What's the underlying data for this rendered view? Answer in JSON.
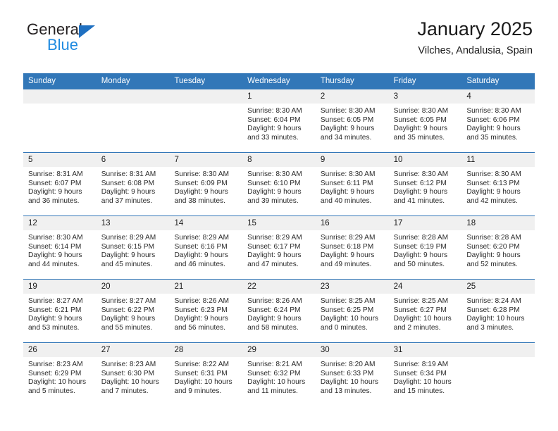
{
  "brand": {
    "name_top": "General",
    "name_bottom": "Blue",
    "triangle_color": "#1f70c1",
    "blue_text_color": "#1f8ae0"
  },
  "header": {
    "title": "January 2025",
    "subtitle": "Vilches, Andalusia, Spain"
  },
  "theme": {
    "header_blue": "#3277b8",
    "daynum_band": "#f0f0f0",
    "cell_bg": "#ffffff",
    "text": "#1a1a1a"
  },
  "weekdays": [
    "Sunday",
    "Monday",
    "Tuesday",
    "Wednesday",
    "Thursday",
    "Friday",
    "Saturday"
  ],
  "weeks": [
    [
      {
        "day": "",
        "lines": []
      },
      {
        "day": "",
        "lines": []
      },
      {
        "day": "",
        "lines": []
      },
      {
        "day": "1",
        "lines": [
          "Sunrise: 8:30 AM",
          "Sunset: 6:04 PM",
          "Daylight: 9 hours",
          "and 33 minutes."
        ]
      },
      {
        "day": "2",
        "lines": [
          "Sunrise: 8:30 AM",
          "Sunset: 6:05 PM",
          "Daylight: 9 hours",
          "and 34 minutes."
        ]
      },
      {
        "day": "3",
        "lines": [
          "Sunrise: 8:30 AM",
          "Sunset: 6:05 PM",
          "Daylight: 9 hours",
          "and 35 minutes."
        ]
      },
      {
        "day": "4",
        "lines": [
          "Sunrise: 8:30 AM",
          "Sunset: 6:06 PM",
          "Daylight: 9 hours",
          "and 35 minutes."
        ]
      }
    ],
    [
      {
        "day": "5",
        "lines": [
          "Sunrise: 8:31 AM",
          "Sunset: 6:07 PM",
          "Daylight: 9 hours",
          "and 36 minutes."
        ]
      },
      {
        "day": "6",
        "lines": [
          "Sunrise: 8:31 AM",
          "Sunset: 6:08 PM",
          "Daylight: 9 hours",
          "and 37 minutes."
        ]
      },
      {
        "day": "7",
        "lines": [
          "Sunrise: 8:30 AM",
          "Sunset: 6:09 PM",
          "Daylight: 9 hours",
          "and 38 minutes."
        ]
      },
      {
        "day": "8",
        "lines": [
          "Sunrise: 8:30 AM",
          "Sunset: 6:10 PM",
          "Daylight: 9 hours",
          "and 39 minutes."
        ]
      },
      {
        "day": "9",
        "lines": [
          "Sunrise: 8:30 AM",
          "Sunset: 6:11 PM",
          "Daylight: 9 hours",
          "and 40 minutes."
        ]
      },
      {
        "day": "10",
        "lines": [
          "Sunrise: 8:30 AM",
          "Sunset: 6:12 PM",
          "Daylight: 9 hours",
          "and 41 minutes."
        ]
      },
      {
        "day": "11",
        "lines": [
          "Sunrise: 8:30 AM",
          "Sunset: 6:13 PM",
          "Daylight: 9 hours",
          "and 42 minutes."
        ]
      }
    ],
    [
      {
        "day": "12",
        "lines": [
          "Sunrise: 8:30 AM",
          "Sunset: 6:14 PM",
          "Daylight: 9 hours",
          "and 44 minutes."
        ]
      },
      {
        "day": "13",
        "lines": [
          "Sunrise: 8:29 AM",
          "Sunset: 6:15 PM",
          "Daylight: 9 hours",
          "and 45 minutes."
        ]
      },
      {
        "day": "14",
        "lines": [
          "Sunrise: 8:29 AM",
          "Sunset: 6:16 PM",
          "Daylight: 9 hours",
          "and 46 minutes."
        ]
      },
      {
        "day": "15",
        "lines": [
          "Sunrise: 8:29 AM",
          "Sunset: 6:17 PM",
          "Daylight: 9 hours",
          "and 47 minutes."
        ]
      },
      {
        "day": "16",
        "lines": [
          "Sunrise: 8:29 AM",
          "Sunset: 6:18 PM",
          "Daylight: 9 hours",
          "and 49 minutes."
        ]
      },
      {
        "day": "17",
        "lines": [
          "Sunrise: 8:28 AM",
          "Sunset: 6:19 PM",
          "Daylight: 9 hours",
          "and 50 minutes."
        ]
      },
      {
        "day": "18",
        "lines": [
          "Sunrise: 8:28 AM",
          "Sunset: 6:20 PM",
          "Daylight: 9 hours",
          "and 52 minutes."
        ]
      }
    ],
    [
      {
        "day": "19",
        "lines": [
          "Sunrise: 8:27 AM",
          "Sunset: 6:21 PM",
          "Daylight: 9 hours",
          "and 53 minutes."
        ]
      },
      {
        "day": "20",
        "lines": [
          "Sunrise: 8:27 AM",
          "Sunset: 6:22 PM",
          "Daylight: 9 hours",
          "and 55 minutes."
        ]
      },
      {
        "day": "21",
        "lines": [
          "Sunrise: 8:26 AM",
          "Sunset: 6:23 PM",
          "Daylight: 9 hours",
          "and 56 minutes."
        ]
      },
      {
        "day": "22",
        "lines": [
          "Sunrise: 8:26 AM",
          "Sunset: 6:24 PM",
          "Daylight: 9 hours",
          "and 58 minutes."
        ]
      },
      {
        "day": "23",
        "lines": [
          "Sunrise: 8:25 AM",
          "Sunset: 6:25 PM",
          "Daylight: 10 hours",
          "and 0 minutes."
        ]
      },
      {
        "day": "24",
        "lines": [
          "Sunrise: 8:25 AM",
          "Sunset: 6:27 PM",
          "Daylight: 10 hours",
          "and 2 minutes."
        ]
      },
      {
        "day": "25",
        "lines": [
          "Sunrise: 8:24 AM",
          "Sunset: 6:28 PM",
          "Daylight: 10 hours",
          "and 3 minutes."
        ]
      }
    ],
    [
      {
        "day": "26",
        "lines": [
          "Sunrise: 8:23 AM",
          "Sunset: 6:29 PM",
          "Daylight: 10 hours",
          "and 5 minutes."
        ]
      },
      {
        "day": "27",
        "lines": [
          "Sunrise: 8:23 AM",
          "Sunset: 6:30 PM",
          "Daylight: 10 hours",
          "and 7 minutes."
        ]
      },
      {
        "day": "28",
        "lines": [
          "Sunrise: 8:22 AM",
          "Sunset: 6:31 PM",
          "Daylight: 10 hours",
          "and 9 minutes."
        ]
      },
      {
        "day": "29",
        "lines": [
          "Sunrise: 8:21 AM",
          "Sunset: 6:32 PM",
          "Daylight: 10 hours",
          "and 11 minutes."
        ]
      },
      {
        "day": "30",
        "lines": [
          "Sunrise: 8:20 AM",
          "Sunset: 6:33 PM",
          "Daylight: 10 hours",
          "and 13 minutes."
        ]
      },
      {
        "day": "31",
        "lines": [
          "Sunrise: 8:19 AM",
          "Sunset: 6:34 PM",
          "Daylight: 10 hours",
          "and 15 minutes."
        ]
      },
      {
        "day": "",
        "lines": []
      }
    ]
  ]
}
